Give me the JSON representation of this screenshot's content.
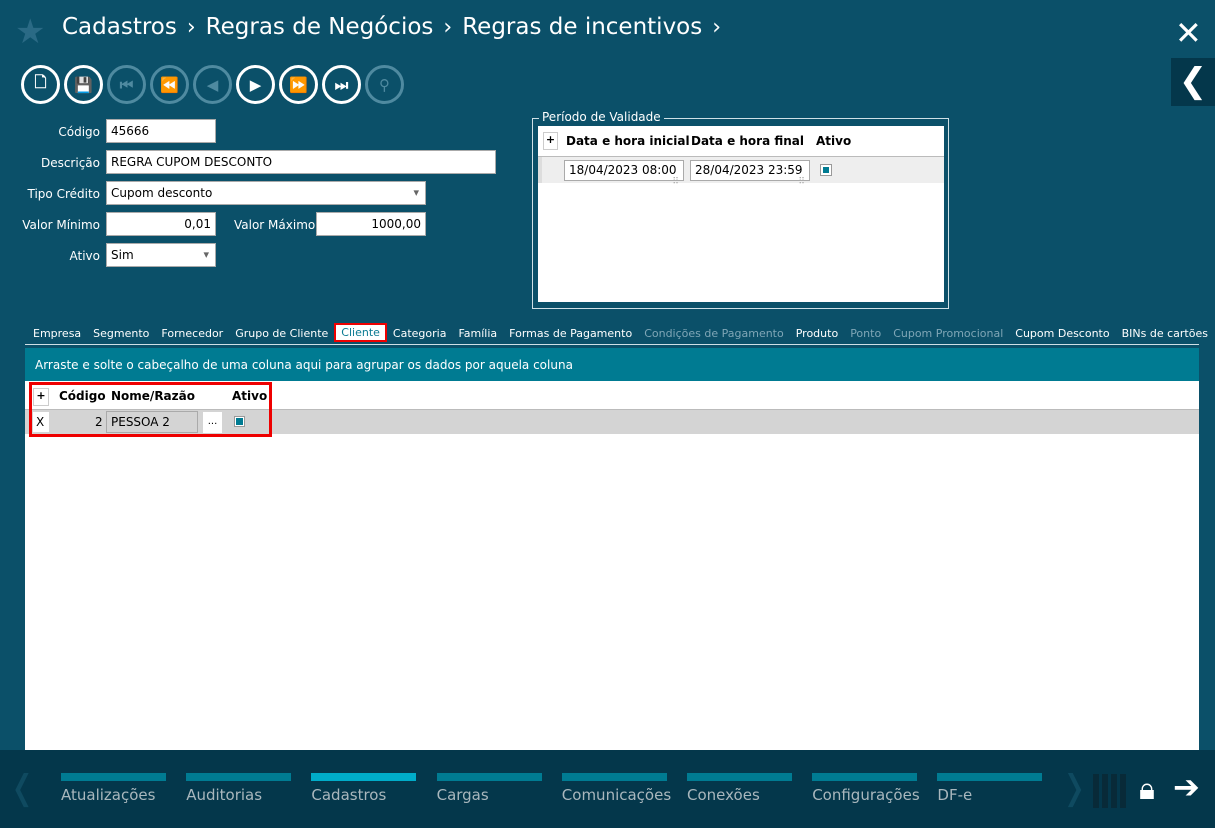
{
  "breadcrumb": [
    "Cadastros",
    "Regras de Negócios",
    "Regras de incentivos"
  ],
  "toolbar": [
    {
      "icon": "new-document-icon",
      "glyph": "🗋",
      "enabled": true
    },
    {
      "icon": "save-icon",
      "glyph": "💾",
      "enabled": true
    },
    {
      "icon": "first-icon",
      "glyph": "⏮",
      "enabled": false
    },
    {
      "icon": "rewind-icon",
      "glyph": "⏪",
      "enabled": false
    },
    {
      "icon": "previous-icon",
      "glyph": "◀",
      "enabled": false
    },
    {
      "icon": "next-icon",
      "glyph": "▶",
      "enabled": true
    },
    {
      "icon": "fast-forward-icon",
      "glyph": "⏩",
      "enabled": true
    },
    {
      "icon": "last-icon",
      "glyph": "⏭",
      "enabled": true
    },
    {
      "icon": "search-icon",
      "glyph": "⚲",
      "enabled": false
    }
  ],
  "form": {
    "codigo_label": "Código",
    "codigo": "45666",
    "descricao_label": "Descrição",
    "descricao": "REGRA CUPOM DESCONTO",
    "tipo_label": "Tipo Crédito",
    "tipo": "Cupom desconto",
    "vmin_label": "Valor Mínimo",
    "vmin": "0,01",
    "vmax_label": "Valor Máximo",
    "vmax": "1000,00",
    "ativo_label": "Ativo",
    "ativo": "Sim"
  },
  "periodo": {
    "title": "Período de Validade",
    "add": "+",
    "cols": [
      "Data e hora inicial",
      "Data e hora final",
      "Ativo"
    ],
    "row": {
      "inicio": "18/04/2023 08:00",
      "fim": "28/04/2023 23:59",
      "ativo": true
    }
  },
  "tabs": [
    {
      "label": "Empresa"
    },
    {
      "label": "Segmento"
    },
    {
      "label": "Fornecedor"
    },
    {
      "label": "Grupo de Cliente"
    },
    {
      "label": "Cliente",
      "active": true
    },
    {
      "label": "Categoria"
    },
    {
      "label": "Família"
    },
    {
      "label": "Formas de Pagamento"
    },
    {
      "label": "Condições de Pagamento",
      "disabled": true
    },
    {
      "label": "Produto"
    },
    {
      "label": "Ponto",
      "disabled": true
    },
    {
      "label": "Cupom Promocional",
      "disabled": true
    },
    {
      "label": "Cupom Desconto"
    },
    {
      "label": "BINs de cartões"
    }
  ],
  "grid": {
    "group_hint": "Arraste e solte o cabeçalho de uma coluna aqui para agrupar os dados por aquela coluna",
    "add": "+",
    "cols": [
      "Código",
      "Nome/Razão",
      "Ativo"
    ],
    "row": {
      "remove": "X",
      "codigo": "2",
      "nome": "PESSOA 2",
      "lookup": "...",
      "ativo": true
    }
  },
  "modules": [
    {
      "label": "Atualizações"
    },
    {
      "label": "Auditorias"
    },
    {
      "label": "Cadastros",
      "active": true
    },
    {
      "label": "Cargas"
    },
    {
      "label": "Comunicações"
    },
    {
      "label": "Conexões"
    },
    {
      "label": "Configurações"
    },
    {
      "label": "DF-e"
    }
  ],
  "colors": {
    "background": "#0b5069",
    "accent": "#007b92",
    "active_module": "#00acc9",
    "highlight": "#e00000"
  }
}
